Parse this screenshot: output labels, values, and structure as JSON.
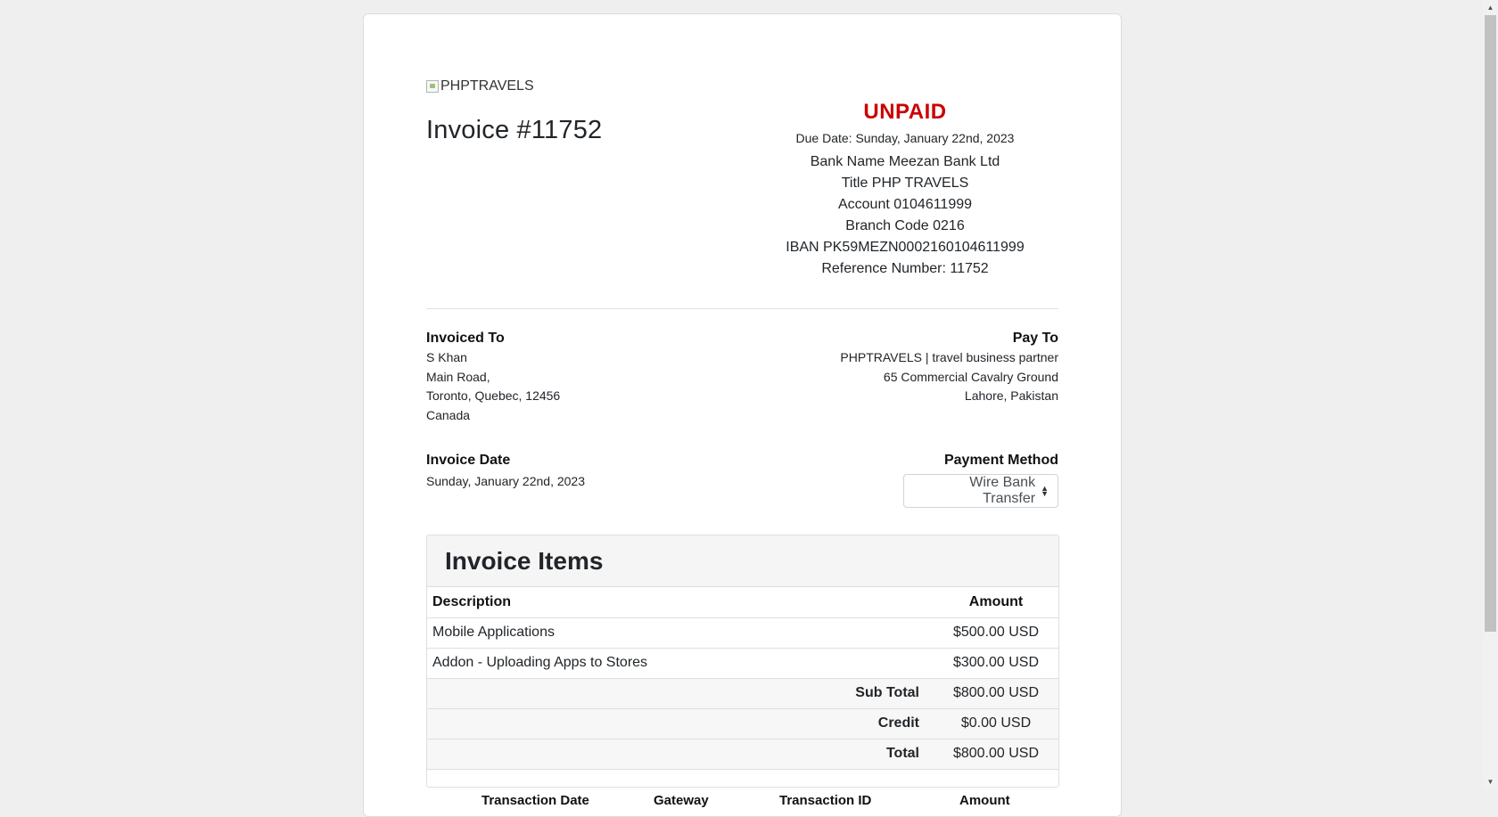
{
  "header": {
    "logo_alt": "PHPTRAVELS",
    "invoice_title": "Invoice #11752"
  },
  "status": {
    "label": "UNPAID",
    "color": "#cc0000",
    "due_date": "Due Date: Sunday, January 22nd, 2023"
  },
  "bank": {
    "lines": [
      "Bank Name Meezan Bank Ltd",
      "Title PHP TRAVELS",
      "Account 0104611999",
      "Branch Code 0216",
      "IBAN PK59MEZN0002160104611999",
      "Reference Number: 11752"
    ]
  },
  "invoiced_to": {
    "label": "Invoiced To",
    "lines": [
      "S Khan",
      "Main Road,",
      "Toronto, Quebec, 12456",
      "Canada"
    ]
  },
  "pay_to": {
    "label": "Pay To",
    "lines": [
      "PHPTRAVELS | travel business partner",
      "65 Commercial Cavalry Ground",
      "Lahore, Pakistan"
    ]
  },
  "invoice_date": {
    "label": "Invoice Date",
    "value": "Sunday, January 22nd, 2023"
  },
  "payment_method": {
    "label": "Payment Method",
    "selected": "Wire Bank Transfer",
    "icon": "select-arrows-icon"
  },
  "items": {
    "title": "Invoice Items",
    "columns": [
      "Description",
      "Amount"
    ],
    "rows": [
      {
        "description": "Mobile Applications",
        "amount": "$500.00 USD"
      },
      {
        "description": "Addon - Uploading Apps to Stores",
        "amount": "$300.00 USD"
      }
    ],
    "summary": [
      {
        "label": "Sub Total",
        "amount": "$800.00 USD"
      },
      {
        "label": "Credit",
        "amount": "$0.00 USD"
      },
      {
        "label": "Total",
        "amount": "$800.00 USD"
      }
    ]
  },
  "transactions": {
    "columns": [
      "Transaction Date",
      "Gateway",
      "Transaction ID",
      "Amount"
    ]
  }
}
